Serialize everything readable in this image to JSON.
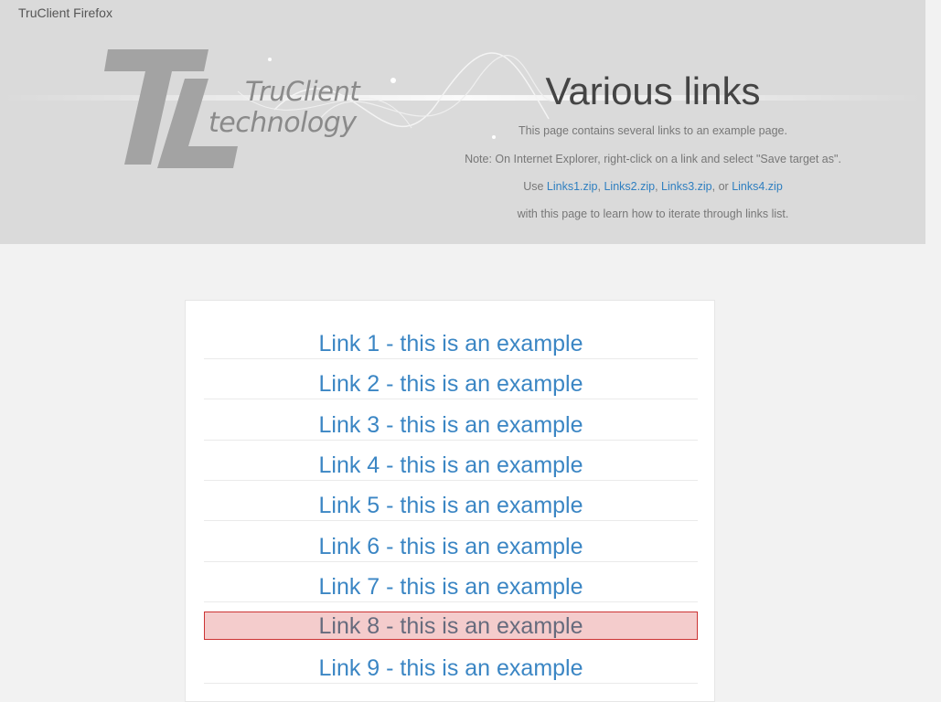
{
  "window": {
    "title": "TruClient Firefox"
  },
  "logo": {
    "line1": "TruClient",
    "line2": "technology"
  },
  "header": {
    "title": "Various links",
    "description": "This page contains several links to an example page.",
    "note": "Note: On Internet Explorer, right-click on a link and select \"Save target as\".",
    "use_prefix": "Use",
    "zip_links": [
      "Links1.zip",
      "Links2.zip",
      "Links3.zip",
      "Links4.zip"
    ],
    "sep_comma": ",",
    "sep_or": ", or",
    "use_suffix": "with this page to learn how to iterate through links list."
  },
  "links": [
    "Link 1 - this is an example",
    "Link 2 - this is an example",
    "Link 3 - this is an example",
    "Link 4 - this is an example",
    "Link 5 - this is an example",
    "Link 6 - this is an example",
    "Link 7 - this is an example",
    "Link 8 - this is an example",
    "Link 9 - this is an example"
  ],
  "highlighted_link": "Link 8 - this is an example",
  "colors": {
    "link": "#3b86c4",
    "highlight_bg": "#f4cccc",
    "highlight_border": "#cc3333",
    "header_bg": "#dadada"
  }
}
